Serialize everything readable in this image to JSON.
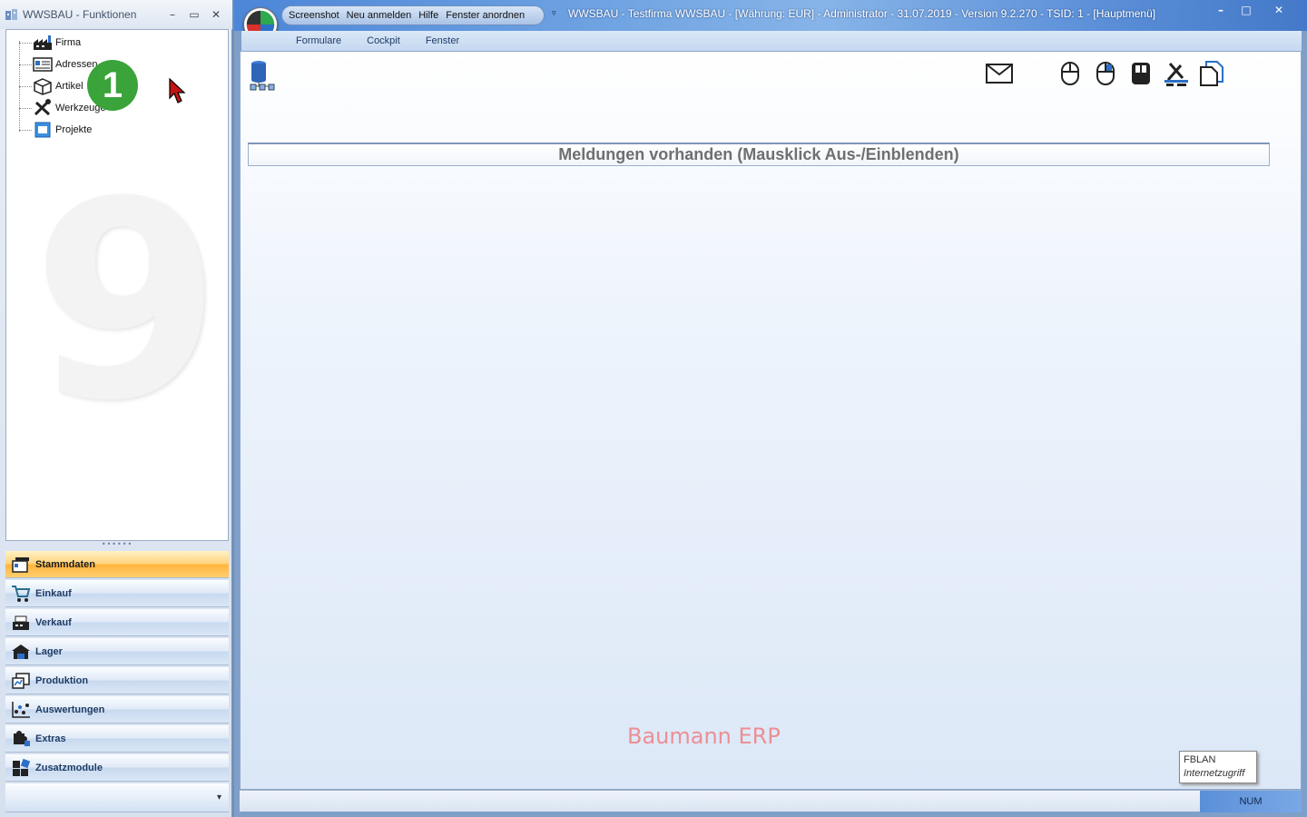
{
  "left_window": {
    "title": "WWSBAU - Funktionen",
    "tree": [
      {
        "label": "Firma",
        "icon": "factory-icon"
      },
      {
        "label": "Adressen",
        "icon": "address-card-icon"
      },
      {
        "label": "Artikel",
        "icon": "box-icon"
      },
      {
        "label": "Werkzeuge",
        "icon": "tools-icon"
      },
      {
        "label": "Projekte",
        "icon": "project-icon"
      }
    ],
    "badge": "1",
    "watermark": "9",
    "nav": [
      {
        "label": "Stammdaten",
        "icon": "master-data-icon",
        "active": true
      },
      {
        "label": "Einkauf",
        "icon": "cart-icon"
      },
      {
        "label": "Verkauf",
        "icon": "cash-register-icon"
      },
      {
        "label": "Lager",
        "icon": "warehouse-icon"
      },
      {
        "label": "Produktion",
        "icon": "production-icon"
      },
      {
        "label": "Auswertungen",
        "icon": "analytics-icon"
      },
      {
        "label": "Extras",
        "icon": "puzzle-icon"
      },
      {
        "label": "Zusatzmodule",
        "icon": "modules-icon"
      }
    ]
  },
  "main_window": {
    "quick_access": [
      "Screenshot",
      "Neu anmelden",
      "Hilfe",
      "Fenster anordnen"
    ],
    "title": "WWSBAU - Testfirma WWSBAU - [Währung: EUR] - Administrator - 31.07.2019 - Version 9.2.270 - TSID: 1  - [Hauptmenü]",
    "ribbon_tabs": [
      "Formulare",
      "Cockpit",
      "Fenster"
    ],
    "messages_bar": "Meldungen vorhanden  (Mausklick Aus-/Einblenden)",
    "brand": "Baumann ERP",
    "network": {
      "line1": "FBLAN",
      "line2": "Internetzugriff"
    },
    "status": {
      "num": "NUM"
    }
  },
  "colors": {
    "accent": "#ffb43c",
    "title_blue": "#4d86d8",
    "brand": "#ec8f95",
    "badge": "#3aa33a"
  }
}
